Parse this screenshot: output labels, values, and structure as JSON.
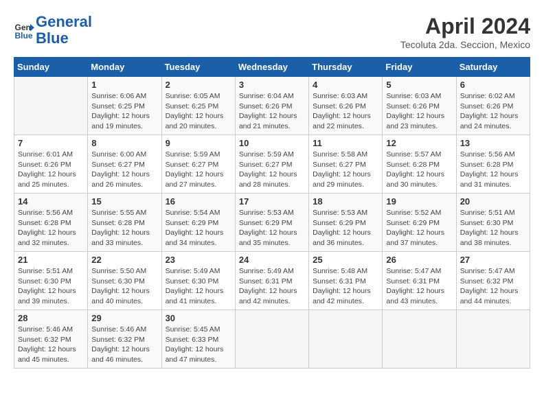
{
  "header": {
    "logo_line1": "General",
    "logo_line2": "Blue",
    "title": "April 2024",
    "subtitle": "Tecoluta 2da. Seccion, Mexico"
  },
  "weekdays": [
    "Sunday",
    "Monday",
    "Tuesday",
    "Wednesday",
    "Thursday",
    "Friday",
    "Saturday"
  ],
  "weeks": [
    [
      {
        "day": "",
        "sunrise": "",
        "sunset": "",
        "daylight": ""
      },
      {
        "day": "1",
        "sunrise": "Sunrise: 6:06 AM",
        "sunset": "Sunset: 6:25 PM",
        "daylight": "Daylight: 12 hours and 19 minutes."
      },
      {
        "day": "2",
        "sunrise": "Sunrise: 6:05 AM",
        "sunset": "Sunset: 6:25 PM",
        "daylight": "Daylight: 12 hours and 20 minutes."
      },
      {
        "day": "3",
        "sunrise": "Sunrise: 6:04 AM",
        "sunset": "Sunset: 6:26 PM",
        "daylight": "Daylight: 12 hours and 21 minutes."
      },
      {
        "day": "4",
        "sunrise": "Sunrise: 6:03 AM",
        "sunset": "Sunset: 6:26 PM",
        "daylight": "Daylight: 12 hours and 22 minutes."
      },
      {
        "day": "5",
        "sunrise": "Sunrise: 6:03 AM",
        "sunset": "Sunset: 6:26 PM",
        "daylight": "Daylight: 12 hours and 23 minutes."
      },
      {
        "day": "6",
        "sunrise": "Sunrise: 6:02 AM",
        "sunset": "Sunset: 6:26 PM",
        "daylight": "Daylight: 12 hours and 24 minutes."
      }
    ],
    [
      {
        "day": "7",
        "sunrise": "Sunrise: 6:01 AM",
        "sunset": "Sunset: 6:26 PM",
        "daylight": "Daylight: 12 hours and 25 minutes."
      },
      {
        "day": "8",
        "sunrise": "Sunrise: 6:00 AM",
        "sunset": "Sunset: 6:27 PM",
        "daylight": "Daylight: 12 hours and 26 minutes."
      },
      {
        "day": "9",
        "sunrise": "Sunrise: 5:59 AM",
        "sunset": "Sunset: 6:27 PM",
        "daylight": "Daylight: 12 hours and 27 minutes."
      },
      {
        "day": "10",
        "sunrise": "Sunrise: 5:59 AM",
        "sunset": "Sunset: 6:27 PM",
        "daylight": "Daylight: 12 hours and 28 minutes."
      },
      {
        "day": "11",
        "sunrise": "Sunrise: 5:58 AM",
        "sunset": "Sunset: 6:27 PM",
        "daylight": "Daylight: 12 hours and 29 minutes."
      },
      {
        "day": "12",
        "sunrise": "Sunrise: 5:57 AM",
        "sunset": "Sunset: 6:28 PM",
        "daylight": "Daylight: 12 hours and 30 minutes."
      },
      {
        "day": "13",
        "sunrise": "Sunrise: 5:56 AM",
        "sunset": "Sunset: 6:28 PM",
        "daylight": "Daylight: 12 hours and 31 minutes."
      }
    ],
    [
      {
        "day": "14",
        "sunrise": "Sunrise: 5:56 AM",
        "sunset": "Sunset: 6:28 PM",
        "daylight": "Daylight: 12 hours and 32 minutes."
      },
      {
        "day": "15",
        "sunrise": "Sunrise: 5:55 AM",
        "sunset": "Sunset: 6:28 PM",
        "daylight": "Daylight: 12 hours and 33 minutes."
      },
      {
        "day": "16",
        "sunrise": "Sunrise: 5:54 AM",
        "sunset": "Sunset: 6:29 PM",
        "daylight": "Daylight: 12 hours and 34 minutes."
      },
      {
        "day": "17",
        "sunrise": "Sunrise: 5:53 AM",
        "sunset": "Sunset: 6:29 PM",
        "daylight": "Daylight: 12 hours and 35 minutes."
      },
      {
        "day": "18",
        "sunrise": "Sunrise: 5:53 AM",
        "sunset": "Sunset: 6:29 PM",
        "daylight": "Daylight: 12 hours and 36 minutes."
      },
      {
        "day": "19",
        "sunrise": "Sunrise: 5:52 AM",
        "sunset": "Sunset: 6:29 PM",
        "daylight": "Daylight: 12 hours and 37 minutes."
      },
      {
        "day": "20",
        "sunrise": "Sunrise: 5:51 AM",
        "sunset": "Sunset: 6:30 PM",
        "daylight": "Daylight: 12 hours and 38 minutes."
      }
    ],
    [
      {
        "day": "21",
        "sunrise": "Sunrise: 5:51 AM",
        "sunset": "Sunset: 6:30 PM",
        "daylight": "Daylight: 12 hours and 39 minutes."
      },
      {
        "day": "22",
        "sunrise": "Sunrise: 5:50 AM",
        "sunset": "Sunset: 6:30 PM",
        "daylight": "Daylight: 12 hours and 40 minutes."
      },
      {
        "day": "23",
        "sunrise": "Sunrise: 5:49 AM",
        "sunset": "Sunset: 6:30 PM",
        "daylight": "Daylight: 12 hours and 41 minutes."
      },
      {
        "day": "24",
        "sunrise": "Sunrise: 5:49 AM",
        "sunset": "Sunset: 6:31 PM",
        "daylight": "Daylight: 12 hours and 42 minutes."
      },
      {
        "day": "25",
        "sunrise": "Sunrise: 5:48 AM",
        "sunset": "Sunset: 6:31 PM",
        "daylight": "Daylight: 12 hours and 42 minutes."
      },
      {
        "day": "26",
        "sunrise": "Sunrise: 5:47 AM",
        "sunset": "Sunset: 6:31 PM",
        "daylight": "Daylight: 12 hours and 43 minutes."
      },
      {
        "day": "27",
        "sunrise": "Sunrise: 5:47 AM",
        "sunset": "Sunset: 6:32 PM",
        "daylight": "Daylight: 12 hours and 44 minutes."
      }
    ],
    [
      {
        "day": "28",
        "sunrise": "Sunrise: 5:46 AM",
        "sunset": "Sunset: 6:32 PM",
        "daylight": "Daylight: 12 hours and 45 minutes."
      },
      {
        "day": "29",
        "sunrise": "Sunrise: 5:46 AM",
        "sunset": "Sunset: 6:32 PM",
        "daylight": "Daylight: 12 hours and 46 minutes."
      },
      {
        "day": "30",
        "sunrise": "Sunrise: 5:45 AM",
        "sunset": "Sunset: 6:33 PM",
        "daylight": "Daylight: 12 hours and 47 minutes."
      },
      {
        "day": "",
        "sunrise": "",
        "sunset": "",
        "daylight": ""
      },
      {
        "day": "",
        "sunrise": "",
        "sunset": "",
        "daylight": ""
      },
      {
        "day": "",
        "sunrise": "",
        "sunset": "",
        "daylight": ""
      },
      {
        "day": "",
        "sunrise": "",
        "sunset": "",
        "daylight": ""
      }
    ]
  ]
}
